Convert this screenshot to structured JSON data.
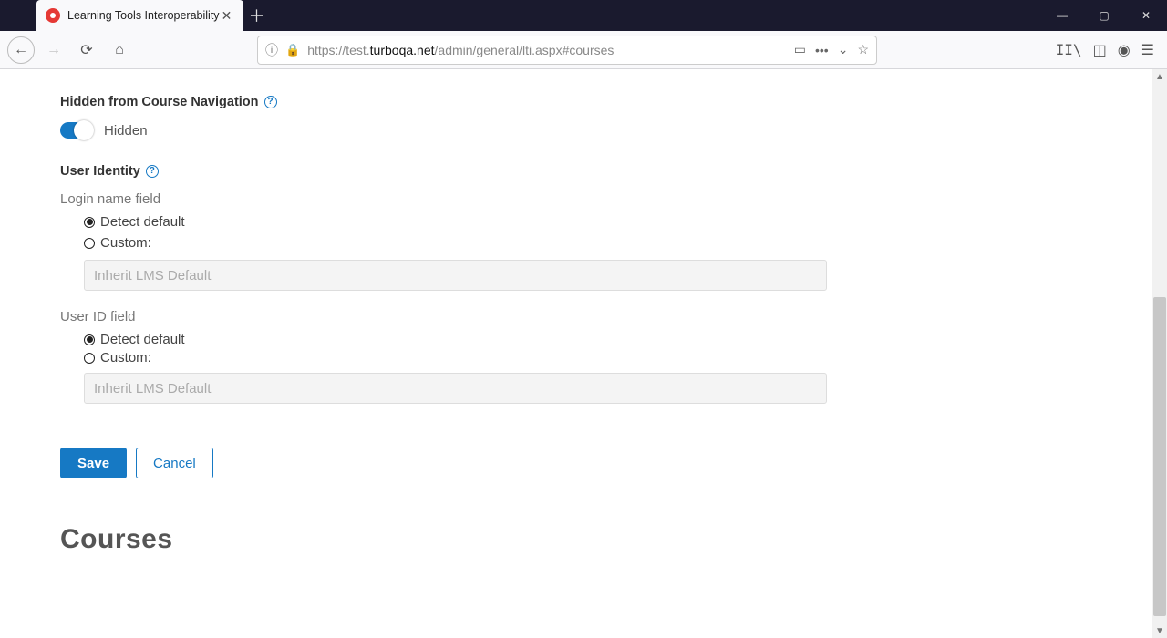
{
  "browser": {
    "tab_title": "Learning Tools Interoperability",
    "url_prefix": "https://test.",
    "url_host": "turboqa.net",
    "url_path": "/admin/general/lti.aspx#courses"
  },
  "sections": {
    "hidden_nav": {
      "title": "Hidden from Course Navigation",
      "toggle_state_label": "Hidden"
    },
    "user_identity": {
      "title": "User Identity",
      "login_field_label": "Login name field",
      "userid_field_label": "User ID field",
      "radio_detect": "Detect default",
      "radio_custom": "Custom:",
      "placeholder": "Inherit LMS Default"
    }
  },
  "buttons": {
    "save": "Save",
    "cancel": "Cancel"
  },
  "headings": {
    "courses": "Courses"
  }
}
